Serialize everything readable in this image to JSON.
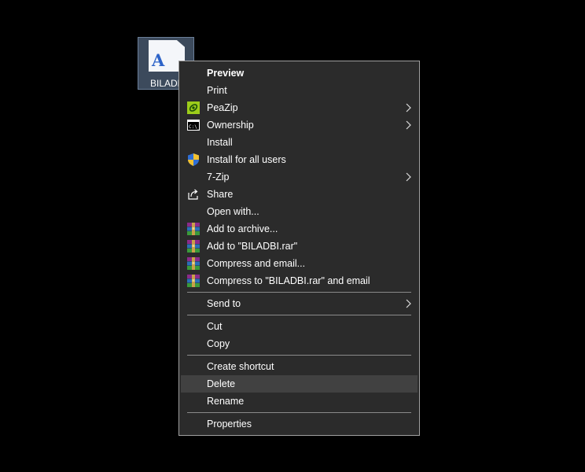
{
  "desktop": {
    "file": {
      "name": "BILADBI",
      "icon": "font-file-icon",
      "glyph": "A"
    }
  },
  "context_menu": {
    "items": [
      {
        "label": "Preview",
        "bold": true
      },
      {
        "label": "Print"
      },
      {
        "label": "PeaZip",
        "icon": "peazip-icon",
        "submenu": true
      },
      {
        "label": "Ownership",
        "icon": "console-icon",
        "submenu": true
      },
      {
        "label": "Install"
      },
      {
        "label": "Install for all users",
        "icon": "uac-shield-icon"
      },
      {
        "label": "7-Zip",
        "submenu": true
      },
      {
        "label": "Share",
        "icon": "share-icon"
      },
      {
        "label": "Open with..."
      },
      {
        "label": "Add to archive...",
        "icon": "winrar-icon"
      },
      {
        "label": "Add to \"BILADBI.rar\"",
        "icon": "winrar-icon"
      },
      {
        "label": "Compress and email...",
        "icon": "winrar-icon"
      },
      {
        "label": "Compress to \"BILADBI.rar\" and email",
        "icon": "winrar-icon"
      },
      {
        "label": "Send to",
        "submenu": true
      },
      {
        "label": "Cut"
      },
      {
        "label": "Copy"
      },
      {
        "label": "Create shortcut"
      },
      {
        "label": "Delete",
        "highlighted": true
      },
      {
        "label": "Rename"
      },
      {
        "label": "Properties"
      }
    ]
  },
  "colors": {
    "menu_bg": "#2b2b2b",
    "menu_border": "#a0a0a0",
    "highlight_bg": "#414141",
    "text": "#ffffff",
    "separator": "#8a8a8a"
  }
}
